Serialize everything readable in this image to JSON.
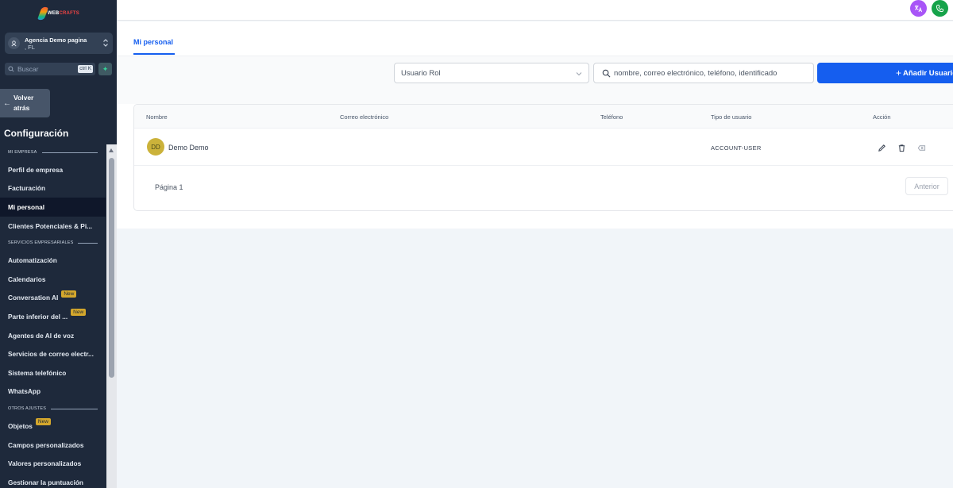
{
  "app": {
    "logo_text_a": "WEB",
    "logo_text_b": "CRAFTS"
  },
  "sidebar": {
    "agency_name": "Agencia Demo pagina",
    "agency_sub": ", FL",
    "search_placeholder": "Buscar",
    "search_shortcut": "ctrl K",
    "back_label": "Volver atrás",
    "config_title": "Configuración",
    "sections": {
      "mi_empresa": "MI EMPRESA",
      "servicios": "SERVICIOS EMPRESARIALES",
      "otros": "OTROS AJUSTES"
    },
    "items": {
      "perfil": "Perfil de empresa",
      "facturacion": "Facturación",
      "mi_personal": "Mi personal",
      "clientes": "Clientes Potenciales & Pi...",
      "automatizacion": "Automatización",
      "calendarios": "Calendarios",
      "conversation_ai": "Conversation AI",
      "parte_inferior": "Parte inferior del ...",
      "agentes_voz": "Agentes de AI de voz",
      "servicios_correo": "Servicios de correo electr...",
      "sistema_telefonico": "Sistema telefónico",
      "whatsapp": "WhatsApp",
      "objetos": "Objetos",
      "campos": "Campos personalizados",
      "valores": "Valores personalizados",
      "gestionar": "Gestionar la puntuación"
    },
    "badge_new": "New"
  },
  "main": {
    "tab_label": "Mi personal",
    "role_select_value": "Usuario Rol",
    "search_placeholder": "nombre, correo electrónico, teléfono, identificado",
    "add_button_label": "Añadir Usuario",
    "columns": {
      "nombre": "Nombre",
      "correo": "Correo electrónico",
      "telefono": "Teléfono",
      "tipo": "Tipo de usuario",
      "accion": "Acción"
    },
    "rows": [
      {
        "initials": "DD",
        "name": "Demo Demo",
        "email": "",
        "phone": "",
        "user_type": "ACCOUNT-USER"
      }
    ],
    "page_label": "Página 1",
    "prev_button": "Anterior"
  },
  "colors": {
    "accent": "#155eef",
    "sidebar_bg": "#1e293b",
    "badge": "#d4a72c",
    "avatar": "#cbb23a"
  },
  "icons": [
    "translate-icon",
    "phone-icon",
    "search-icon",
    "sparkle-icon",
    "arrow-left-icon",
    "chevron-updown-icon",
    "chevron-down-icon",
    "edit-icon",
    "trash-icon",
    "close-square-icon"
  ]
}
